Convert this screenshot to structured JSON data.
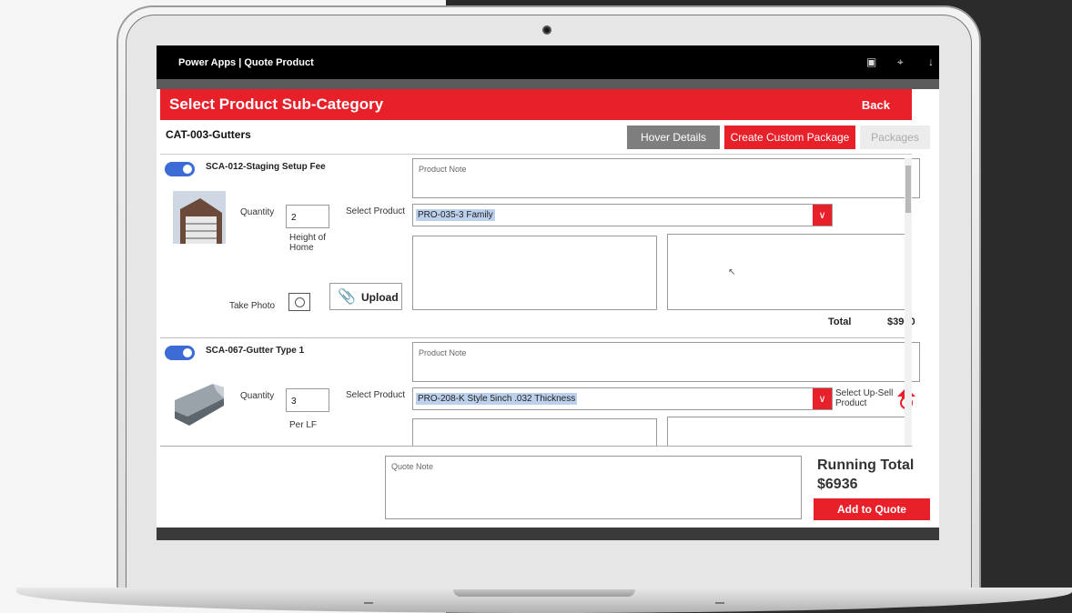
{
  "powerapps": {
    "title": "Power Apps  |  Quote Product"
  },
  "header": {
    "title": "Select Product Sub-Category",
    "back_label": "Back"
  },
  "category": {
    "label": "CAT-003-Gutters",
    "buttons": {
      "hover_details": "Hover Details",
      "create_custom_package": "Create Custom Package",
      "packages": "Packages"
    }
  },
  "items": [
    {
      "title": "SCA-012-Staging Setup Fee",
      "note_placeholder": "Product Note",
      "quantity_label": "Quantity",
      "quantity_value": "2",
      "unit_label": "Height of Home",
      "select_product_label": "Select Product",
      "selected_product": "PRO-035-3 Family",
      "take_photo_label": "Take Photo",
      "upload_label": "Upload",
      "total_label": "Total",
      "total_value": "$3960"
    },
    {
      "title": "SCA-067-Gutter Type 1",
      "note_placeholder": "Product Note",
      "quantity_label": "Quantity",
      "quantity_value": "3",
      "unit_label": "Per LF",
      "select_product_label": "Select Product",
      "selected_product": "PRO-208-K Style 5inch .032 Thickness",
      "upsell_label": "Select Up-Sell Product"
    }
  ],
  "footer": {
    "quote_note_placeholder": "Quote Note",
    "running_total_label": "Running Total",
    "running_total_value": "$6936",
    "add_to_quote_label": "Add to Quote"
  },
  "colors": {
    "accent": "#e8202a",
    "toggle": "#3c6bd6",
    "neutral_button": "#7e7e7e"
  }
}
